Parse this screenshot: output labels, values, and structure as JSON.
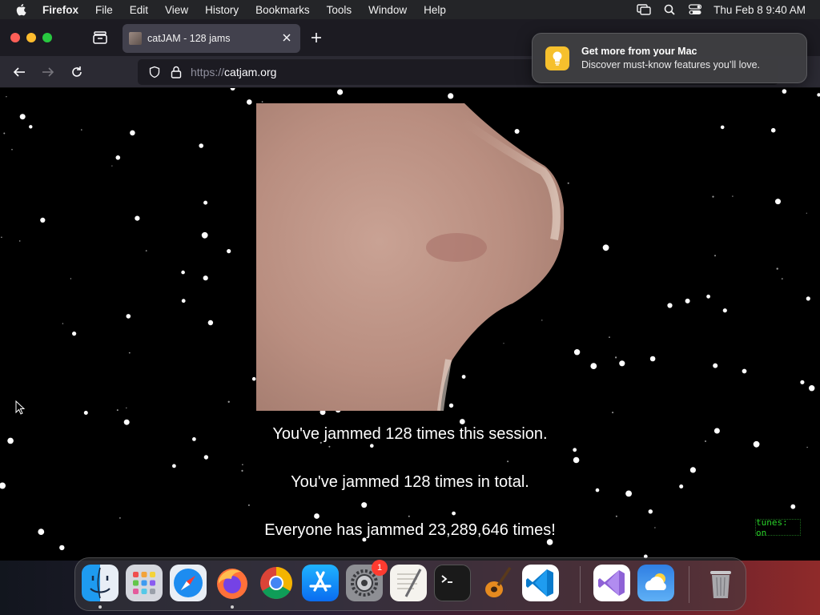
{
  "menubar": {
    "app_name": "Firefox",
    "menus": [
      "File",
      "Edit",
      "View",
      "History",
      "Bookmarks",
      "Tools",
      "Window",
      "Help"
    ],
    "clock": "Thu Feb 8  9:40 AM"
  },
  "browser": {
    "tab_title": "catJAM - 128 jams",
    "url_prefix": "https://",
    "url_domain": "catjam.org"
  },
  "notification": {
    "title": "Get more from your Mac",
    "subtitle": "Discover must-know features you’ll love."
  },
  "page": {
    "session_text": "You've jammed 128 times this session.",
    "total_text": "You've jammed 128 times in total.",
    "everyone_text": "Everyone has jammed 23,289,646 times!",
    "tunes_label": "tunes: on"
  },
  "dock": {
    "apps": [
      "Finder",
      "Launchpad",
      "Safari",
      "Firefox",
      "Chrome",
      "App Store",
      "System Settings",
      "TextEdit",
      "Terminal",
      "GarageBand",
      "Visual Studio Code",
      "Visual Studio",
      "Weather",
      "Trash"
    ],
    "settings_badge": "1"
  }
}
